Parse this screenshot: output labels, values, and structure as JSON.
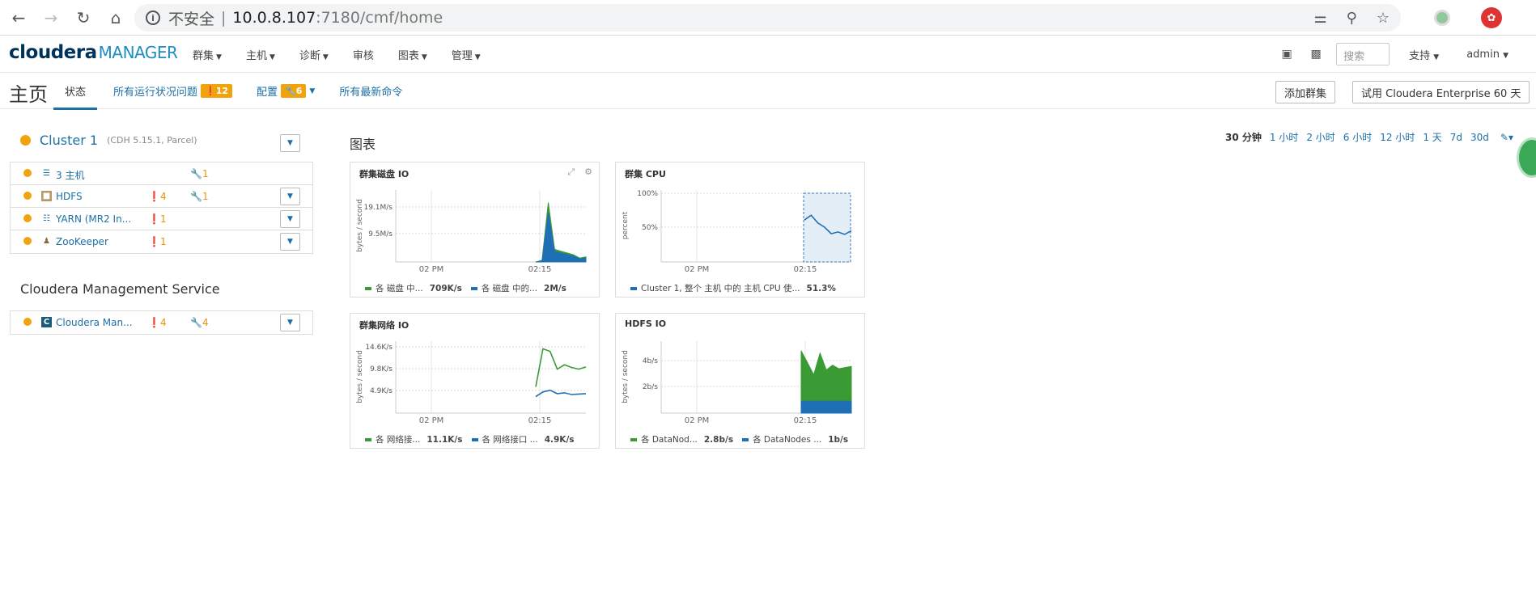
{
  "browser": {
    "security_label": "不安全",
    "url_host": "10.0.8.107",
    "url_path": ":7180/cmf/home"
  },
  "header": {
    "logo_main": "cloudera",
    "logo_sub": "MANAGER",
    "menu": [
      {
        "label": "群集",
        "has_caret": true
      },
      {
        "label": "主机",
        "has_caret": true
      },
      {
        "label": "诊断",
        "has_caret": true
      },
      {
        "label": "审核",
        "has_caret": false
      },
      {
        "label": "图表",
        "has_caret": true
      },
      {
        "label": "管理",
        "has_caret": true
      }
    ],
    "search_placeholder": "搜索",
    "support_label": "支持",
    "user_label": "admin"
  },
  "subheader": {
    "title": "主页",
    "tabs": {
      "status": "状态",
      "health_issues": "所有运行状况问题",
      "health_issues_count": "12",
      "config": "配置",
      "config_count": "6",
      "recent_commands": "所有最新命令"
    },
    "add_cluster": "添加群集",
    "trial": "试用 Cloudera Enterprise 60 天"
  },
  "cluster": {
    "name": "Cluster 1",
    "version": "(CDH 5.15.1, Parcel)",
    "rows": [
      {
        "icon": "hosts-list-icon",
        "name": "3 主机",
        "warn": "",
        "conf": "1",
        "dropdown": false
      },
      {
        "icon": "hdfs-icon",
        "name": "HDFS",
        "warn": "4",
        "conf": "1",
        "dropdown": true
      },
      {
        "icon": "yarn-icon",
        "name": "YARN (MR2 In...",
        "warn": "1",
        "conf": "",
        "dropdown": true
      },
      {
        "icon": "zookeeper-icon",
        "name": "ZooKeeper",
        "warn": "1",
        "conf": "",
        "dropdown": true
      }
    ]
  },
  "mgmt": {
    "title": "Cloudera Management Service",
    "row": {
      "name": "Cloudera Man...",
      "warn": "4",
      "conf": "4"
    }
  },
  "charts_section": {
    "title": "图表",
    "time_ranges": [
      "30 分钟",
      "1 小时",
      "2 小时",
      "6 小时",
      "12 小时",
      "1 天",
      "7d",
      "30d"
    ],
    "active_range": "30 分钟"
  },
  "chart_data": [
    {
      "type": "area",
      "title": "群集磁盘 IO",
      "ylabel": "bytes / second",
      "ytick_labels": [
        "19.1M/s",
        "9.5M/s"
      ],
      "xtick_labels": [
        "02 PM",
        "02:15"
      ],
      "series": [
        {
          "name": "各 磁盘 中...",
          "color": "#3a9b35",
          "latest": "709K/s",
          "values": [
            0,
            0.5,
            19.8,
            4.2,
            3.6,
            3.0,
            2.4,
            1.3,
            1.7
          ]
        },
        {
          "name": "各 磁盘 中的...",
          "color": "#1f6fb5",
          "latest": "2M/s",
          "values": [
            0,
            0.4,
            16.5,
            3.5,
            3.0,
            2.5,
            2.0,
            1.0,
            1.4
          ]
        }
      ]
    },
    {
      "type": "line",
      "title": "群集 CPU",
      "ylabel": "percent",
      "ytick_labels": [
        "100%",
        "50%"
      ],
      "xtick_labels": [
        "02 PM",
        "02:15"
      ],
      "series": [
        {
          "name": "Cluster 1, 整个 主机 中的 主机 CPU 使...",
          "color": "#1f6fb5",
          "latest": "51.3%",
          "values": [
            70,
            78,
            65,
            58,
            47,
            50,
            46,
            52
          ]
        }
      ]
    },
    {
      "type": "line",
      "title": "群集网络 IO",
      "ylabel": "bytes / second",
      "ytick_labels": [
        "14.6K/s",
        "9.8K/s",
        "4.9K/s"
      ],
      "xtick_labels": [
        "02 PM",
        "02:15"
      ],
      "series": [
        {
          "name": "各 网络接...",
          "color": "#3a9b35",
          "latest": "11.1K/s",
          "values": [
            6.2,
            15.2,
            14.6,
            10.4,
            11.4,
            10.8,
            10.4,
            10.9
          ]
        },
        {
          "name": "各 网络接口 ...",
          "color": "#1f6fb5",
          "latest": "4.9K/s",
          "values": [
            3.9,
            5.0,
            5.4,
            4.6,
            4.8,
            4.4,
            4.5,
            4.6
          ]
        }
      ]
    },
    {
      "type": "area",
      "title": "HDFS IO",
      "ylabel": "bytes / second",
      "ytick_labels": [
        "4b/s",
        "2b/s"
      ],
      "xtick_labels": [
        "02 PM",
        "02:15"
      ],
      "series": [
        {
          "name": "各 DataNod...",
          "color": "#3a9b35",
          "latest": "2.8b/s",
          "values": [
            5.2,
            4.2,
            3.2,
            5.0,
            3.6,
            4.0,
            3.7,
            3.8,
            3.9
          ]
        },
        {
          "name": "各 DataNodes ...",
          "color": "#1f6fb5",
          "latest": "1b/s",
          "values": [
            1.0,
            1.0,
            1.0,
            1.0,
            1.0,
            1.0,
            1.0,
            1.0,
            1.0
          ]
        }
      ]
    }
  ]
}
